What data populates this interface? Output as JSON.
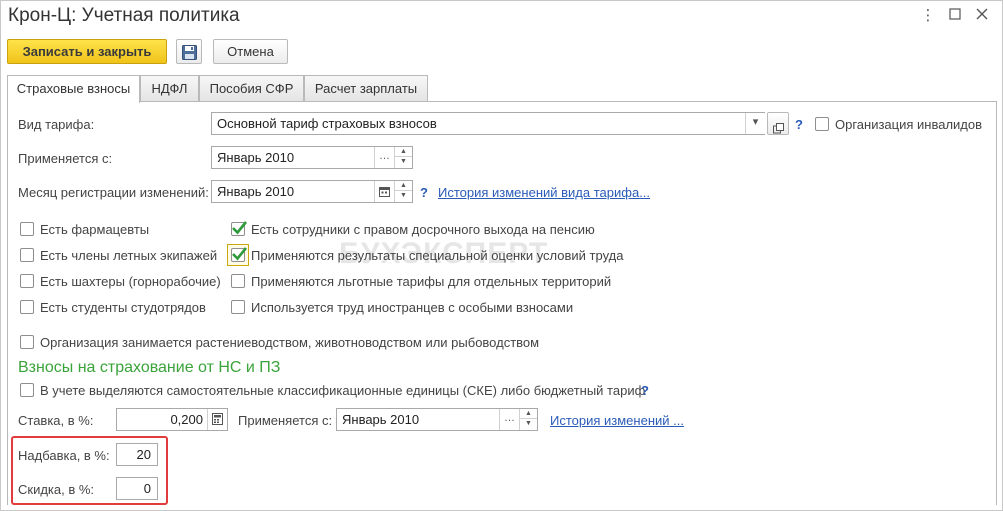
{
  "window": {
    "title": "Крон-Ц: Учетная политика"
  },
  "toolbar": {
    "save_close": "Записать и закрыть",
    "cancel": "Отмена"
  },
  "tabs": [
    "Страховые взносы",
    "НДФЛ",
    "Пособия СФР",
    "Расчет зарплаты"
  ],
  "tariff": {
    "label": "Вид тарифа:",
    "value": "Основной тариф страховых взносов",
    "help": "?",
    "invalids_label": "Организация инвалидов"
  },
  "applied": {
    "label": "Применяется с:",
    "value": "Январь 2010"
  },
  "reg_month": {
    "label": "Месяц регистрации изменений:",
    "value": "Январь 2010",
    "help": "?",
    "history_link": "История изменений вида тарифа..."
  },
  "checks_left": [
    {
      "label": "Есть фармацевты",
      "checked": false
    },
    {
      "label": "Есть члены летных экипажей",
      "checked": false
    },
    {
      "label": "Есть шахтеры (горнорабочие)",
      "checked": false
    },
    {
      "label": "Есть студенты студотрядов",
      "checked": false
    }
  ],
  "checks_right": [
    {
      "label": "Есть сотрудники с правом досрочного выхода на пенсию",
      "checked": true
    },
    {
      "label": "Применяются результаты специальной оценки условий труда",
      "checked": true
    },
    {
      "label": "Применяются льготные тарифы для отдельных территорий",
      "checked": false
    },
    {
      "label": "Используется труд иностранцев с особыми взносами",
      "checked": false
    }
  ],
  "agri": {
    "label": "Организация занимается растениеводством, животноводством или рыбоводством",
    "checked": false
  },
  "watermark": "БУХЭКСПЕРТ",
  "ns": {
    "title": "Взносы на страхование от НС и ПЗ",
    "ske_label": "В учете выделяются самостоятельные классификационные единицы (СКЕ) либо бюджетный тариф",
    "ske_checked": false,
    "help": "?",
    "rate_label": "Ставка, в %:",
    "rate_value": "0,200",
    "applied_label": "Применяется с:",
    "applied_value": "Январь 2010",
    "history_link": "История изменений ...",
    "markup_label": "Надбавка, в %:",
    "markup_value": "20",
    "discount_label": "Скидка, в %:",
    "discount_value": "0"
  },
  "colors": {
    "primary_button": "#f5cd2a",
    "section_title": "#3aa33a",
    "link": "#2a5bb8",
    "highlight": "#e23b3b"
  }
}
